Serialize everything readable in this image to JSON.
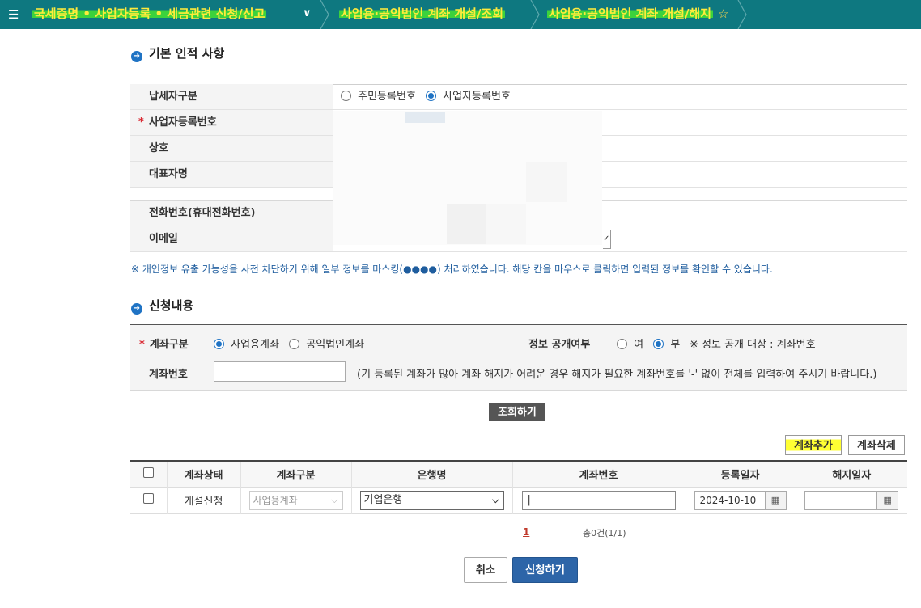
{
  "nav": {
    "crumb1": "국세증명 • 사업자등록 • 세금관련 신청/신고",
    "crumb2": "사업용·공익법인 계좌 개설/조회",
    "crumb3": "사업용·공익법인 계좌 개설/해지"
  },
  "basic": {
    "title": "기본 인적 사항",
    "rows": [
      {
        "label": "납세자구분"
      },
      {
        "label": "사업자등록번호",
        "required": true
      },
      {
        "label": "상호"
      },
      {
        "label": "대표자명"
      },
      {
        "label": "전화번호(휴대전화번호)"
      },
      {
        "label": "이메일"
      }
    ],
    "taxpayer_type": {
      "opt1": "주민등록번호",
      "opt2": "사업자등록번호",
      "selected": "사업자등록번호"
    },
    "notice": "※ 개인정보 유출 가능성을 사전 차단하기 위해 일부 정보를 마스킹(●●●●) 처리하였습니다. 해당 칸을 마우스로 클릭하면 입력된 정보를 확인할 수 있습니다."
  },
  "apply": {
    "title": "신청내용",
    "account_type_label": "계좌구분",
    "opt_business": "사업용계좌",
    "opt_public": "공익법인계좌",
    "disclose_label": "정보 공개여부",
    "opt_yes": "여",
    "opt_no": "부",
    "disclose_note": "※ 정보 공개 대상 : 계좌번호",
    "account_no_label": "계좌번호",
    "account_no_value": "",
    "hint": "(기 등록된 계좌가 많아 계좌 해지가 어려운 경우 해지가 필요한 계좌번호를 '-' 없이 전체를 입력하여 주시기 바랍니다.)",
    "search_btn": "조회하기"
  },
  "buttons": {
    "add": "계좌추가",
    "delete": "계좌삭제",
    "cancel": "취소",
    "submit": "신청하기"
  },
  "table": {
    "headers": [
      "계좌상태",
      "계좌구분",
      "은행명",
      "계좌번호",
      "등록일자",
      "해지일자"
    ],
    "row": {
      "status": "개설신청",
      "account_type": "사업용계좌",
      "bank": "기업은행",
      "account_no": "|",
      "reg_date": "2024-10-10",
      "close_date": ""
    }
  },
  "pager": {
    "page": "1",
    "total": "총0건(1/1)"
  }
}
